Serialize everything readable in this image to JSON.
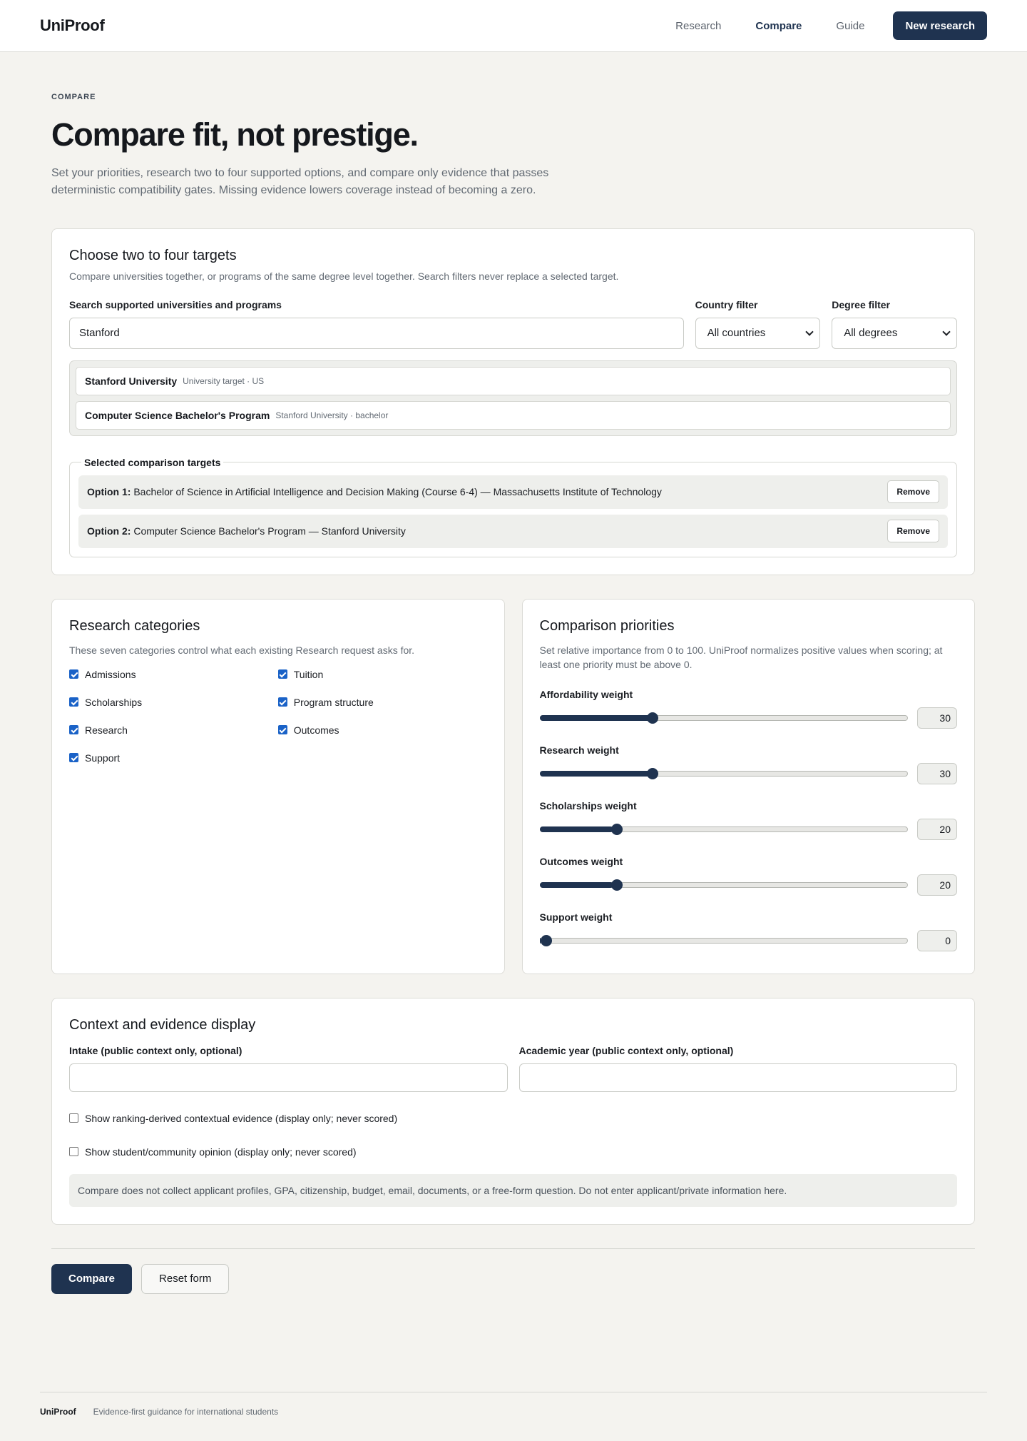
{
  "header": {
    "brand": "UniProof",
    "nav": [
      {
        "label": "Research",
        "active": false
      },
      {
        "label": "Compare",
        "active": true
      },
      {
        "label": "Guide",
        "active": false
      }
    ],
    "cta_label": "New research"
  },
  "hero": {
    "eyebrow": "COMPARE",
    "title": "Compare fit, not prestige.",
    "lead": "Set your priorities, research two to four supported options, and compare only evidence that passes deterministic compatibility gates. Missing evidence lowers coverage instead of becoming a zero."
  },
  "targets_card": {
    "title": "Choose two to four targets",
    "subtitle": "Compare universities together, or programs of the same degree level together. Search filters never replace a selected target.",
    "search_label": "Search supported universities and programs",
    "search_value": "Stanford",
    "country_label": "Country filter",
    "country_value": "All countries",
    "degree_label": "Degree filter",
    "degree_value": "All degrees",
    "results": [
      {
        "name": "Stanford University",
        "meta": "University target · US"
      },
      {
        "name": "Computer Science Bachelor's Program",
        "meta": "Stanford University · bachelor"
      }
    ],
    "selected_legend": "Selected comparison targets",
    "selected": [
      {
        "prefix": "Option 1:",
        "text": "Bachelor of Science in Artificial Intelligence and Decision Making (Course 6-4) — Massachusetts Institute of Technology",
        "remove_label": "Remove"
      },
      {
        "prefix": "Option 2:",
        "text": "Computer Science Bachelor's Program — Stanford University",
        "remove_label": "Remove"
      }
    ]
  },
  "categories_card": {
    "title": "Research categories",
    "subtitle": "These seven categories control what each existing Research request asks for.",
    "items": [
      {
        "label": "Admissions",
        "checked": true
      },
      {
        "label": "Tuition",
        "checked": true
      },
      {
        "label": "Scholarships",
        "checked": true
      },
      {
        "label": "Program structure",
        "checked": true
      },
      {
        "label": "Research",
        "checked": true
      },
      {
        "label": "Outcomes",
        "checked": true
      },
      {
        "label": "Support",
        "checked": true
      }
    ]
  },
  "priorities_card": {
    "title": "Comparison priorities",
    "subtitle": "Set relative importance from 0 to 100. UniProof normalizes positive values when scoring; at least one priority must be above 0.",
    "range_max": 100,
    "weights": [
      {
        "label": "Affordability weight",
        "value": 30
      },
      {
        "label": "Research weight",
        "value": 30
      },
      {
        "label": "Scholarships weight",
        "value": 20
      },
      {
        "label": "Outcomes weight",
        "value": 20
      },
      {
        "label": "Support weight",
        "value": 0
      }
    ]
  },
  "context_card": {
    "title": "Context and evidence display",
    "intake_label": "Intake (public context only, optional)",
    "intake_value": "",
    "year_label": "Academic year (public context only, optional)",
    "year_value": "",
    "options": [
      {
        "label": "Show ranking-derived contextual evidence (display only; never scored)",
        "checked": false
      },
      {
        "label": "Show student/community opinion (display only; never scored)",
        "checked": false
      }
    ],
    "notice": "Compare does not collect applicant profiles, GPA, citizenship, budget, email, documents, or a free-form question. Do not enter applicant/private information here."
  },
  "actions": {
    "submit_label": "Compare",
    "reset_label": "Reset form"
  },
  "footer": {
    "brand": "UniProof",
    "tagline": "Evidence-first guidance for international students"
  },
  "colors": {
    "accent": "#1f3350",
    "checkbox": "#1a62c7",
    "background": "#f4f3ef"
  }
}
